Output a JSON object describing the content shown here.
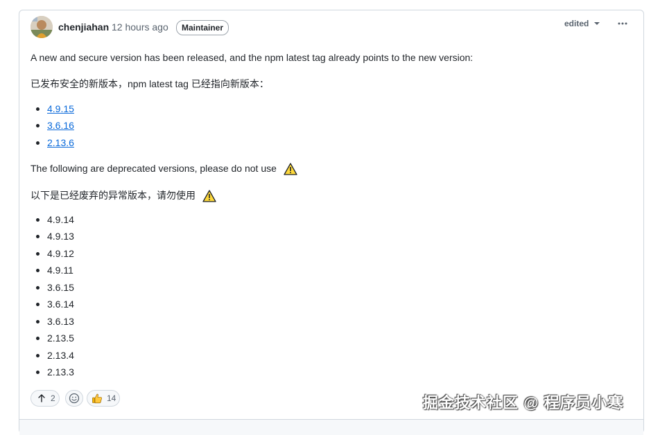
{
  "comment": {
    "author": "chenjiahan",
    "timestamp": "12 hours ago",
    "role_badge": "Maintainer",
    "edited_label": "edited",
    "menu_icon": "kebab-horizontal-icon",
    "paragraphs": {
      "release_en": "A new and secure version has been released, and the npm latest tag already points to the new version:",
      "release_zh": "已发布安全的新版本，npm latest tag 已经指向新版本：",
      "deprecated_en": "The following are deprecated versions, please do not use",
      "deprecated_zh": "以下是已经废弃的异常版本，请勿使用"
    },
    "safe_versions": [
      "4.9.15",
      "3.6.16",
      "2.13.6"
    ],
    "deprecated_versions": [
      "4.9.14",
      "4.9.13",
      "4.9.12",
      "4.9.11",
      "3.6.15",
      "3.6.14",
      "3.6.13",
      "2.13.5",
      "2.13.4",
      "2.13.3"
    ],
    "reactions": {
      "upvote": {
        "icon": "arrow-up-icon",
        "count": "2"
      },
      "add_reaction": {
        "icon": "smiley-icon"
      },
      "thumbs_up": {
        "icon": "thumbs-up-icon",
        "count": "14"
      }
    }
  },
  "watermark": "掘金技术社区 @ 程序员小寒",
  "colors": {
    "link": "#0969da",
    "border": "#d0d7de",
    "muted_text": "#59636e",
    "warning_fill": "#ffd93b"
  }
}
